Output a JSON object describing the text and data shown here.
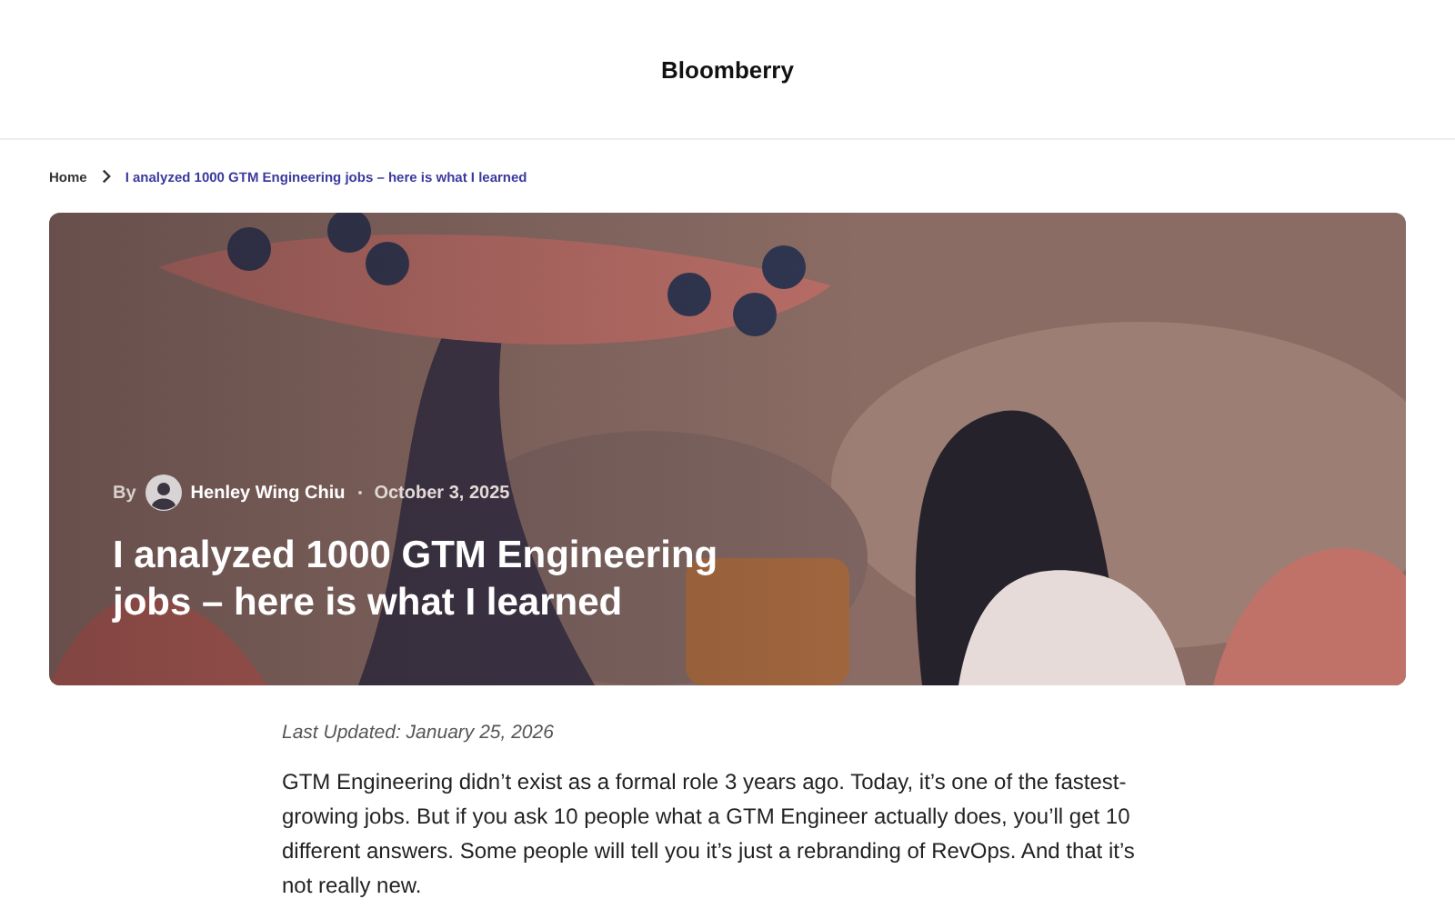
{
  "header": {
    "logo": "Bloomberry"
  },
  "breadcrumb": [
    {
      "label": "Home",
      "current": false
    },
    {
      "label": "I analyzed 1000 GTM Engineering jobs – here is what I learned",
      "current": true
    }
  ],
  "hero": {
    "kind": "picture",
    "by": "By",
    "author": "Henley Wing Chiu",
    "date": "October 3, 2025",
    "title": "I analyzed 1000 GTM Engineering jobs – here is what I learned"
  },
  "article": {
    "updated": "Last Updated: January 25, 2026",
    "paragraph": "GTM Engineering didn’t exist as a formal role 3 years ago. Today, it’s one of the fastest-growing jobs. But if you ask 10 people what a GTM Engineer actually does, you’ll get 10 different answers. Some people will tell you it’s just a rebranding of RevOps. And that it’s not really new."
  }
}
